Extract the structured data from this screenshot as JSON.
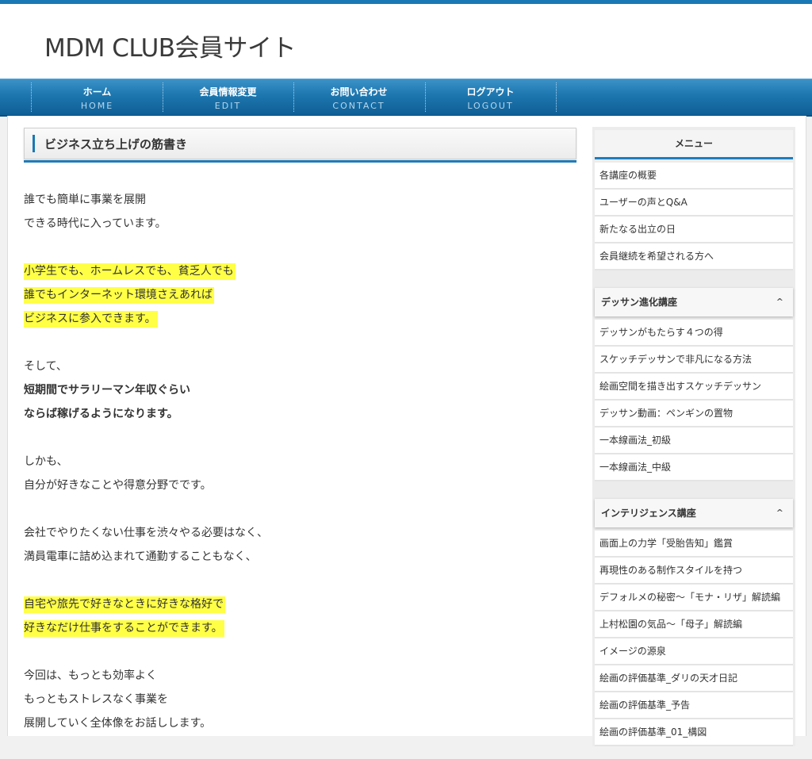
{
  "site": {
    "title": "MDM CLUB会員サイト"
  },
  "nav": [
    {
      "jp": "ホーム",
      "en": "HOME"
    },
    {
      "jp": "会員情報変更",
      "en": "EDIT"
    },
    {
      "jp": "お問い合わせ",
      "en": "CONTACT"
    },
    {
      "jp": "ログアウト",
      "en": "LOGOUT"
    }
  ],
  "post": {
    "title": "ビジネス立ち上げの筋書き",
    "paragraphs": [
      {
        "lines": [
          {
            "text": "誰でも簡単に事業を展開"
          },
          {
            "text": "できる時代に入っています。"
          }
        ]
      },
      {
        "lines": [
          {
            "text": "小学生でも、ホームレスでも、貧乏人でも",
            "highlight": true
          },
          {
            "text": "誰でもインターネット環境さえあれば",
            "highlight": true
          },
          {
            "text": "ビジネスに参入できます。",
            "highlight": true
          }
        ]
      },
      {
        "lines": [
          {
            "text": "そして、"
          },
          {
            "text": "短期間でサラリーマン年収ぐらい",
            "bold": true
          },
          {
            "text": "ならば稼げるようになります。",
            "bold": true
          }
        ]
      },
      {
        "lines": [
          {
            "text": "しかも、"
          },
          {
            "text": "自分が好きなことや得意分野でです。"
          }
        ]
      },
      {
        "lines": [
          {
            "text": "会社でやりたくない仕事を渋々やる必要はなく、"
          },
          {
            "text": "満員電車に詰め込まれて通勤することもなく、"
          }
        ]
      },
      {
        "lines": [
          {
            "text": "自宅や旅先で好きなときに好きな格好で",
            "highlight": true
          },
          {
            "text": "好きなだけ仕事をすることができます。",
            "highlight": true
          }
        ]
      },
      {
        "lines": [
          {
            "text": "今回は、もっとも効率よく"
          },
          {
            "text": "もっともストレスなく事業を"
          },
          {
            "text": "展開していく全体像をお話しします。"
          }
        ]
      }
    ]
  },
  "sidebar": {
    "menu_title": "メニュー",
    "menu_items": [
      "各講座の概要",
      "ユーザーの声とQ&A",
      "新たなる出立の日",
      "会員継続を希望される方へ"
    ],
    "categories": [
      {
        "title": "デッサン進化講座",
        "chevron": "^",
        "items": [
          "デッサンがもたらす４つの得",
          "スケッチデッサンで非凡になる方法",
          "絵画空間を描き出すスケッチデッサン",
          "デッサン動画：ペンギンの置物",
          "一本線画法_初級",
          "一本線画法_中級"
        ]
      },
      {
        "title": "インテリジェンス講座",
        "chevron": "^",
        "items": [
          "画面上の力学「受胎告知」鑑賞",
          "再現性のある制作スタイルを持つ",
          "デフォルメの秘密〜「モナ・リザ」解読編",
          "上村松園の気品〜「母子」解読編",
          "イメージの源泉",
          "絵画の評価基準_ダリの天才日記",
          "絵画の評価基準_予告",
          "絵画の評価基準_01_構図"
        ]
      }
    ]
  }
}
